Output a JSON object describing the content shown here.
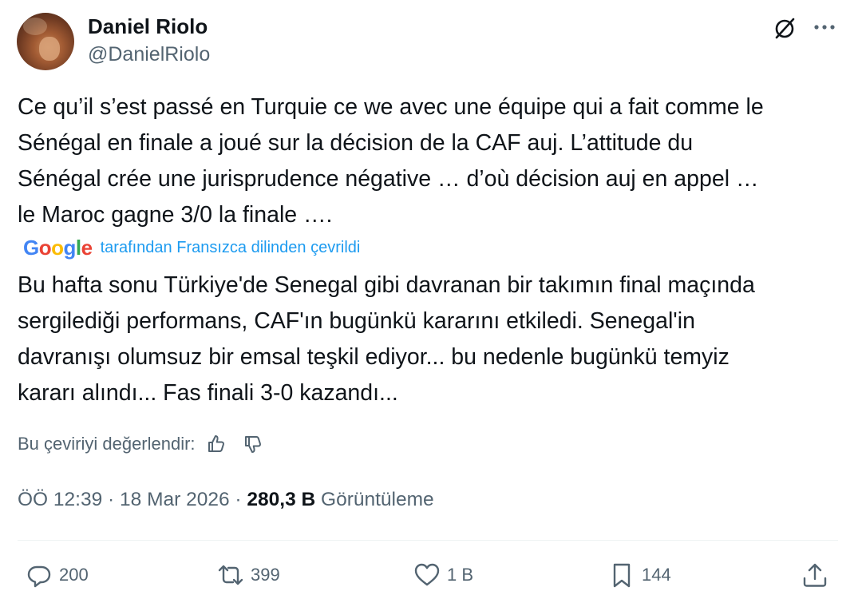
{
  "author": {
    "name": "Daniel Riolo",
    "handle": "@DanielRiolo"
  },
  "tweet": {
    "original_lines": [
      "Ce qu’il s’est passé en Turquie ce we avec une équipe qui a fait comme le",
      "Sénégal en finale a joué sur la décision de la CAF auj. L’attitude du",
      "Sénégal crée une jurisprudence négative … d’où décision auj en appel …",
      "le Maroc gagne 3/0 la finale …."
    ],
    "translation_credit": "tarafından Fransızca dilinden çevrildi",
    "translated_lines": [
      "Bu hafta sonu Türkiye'de Senegal gibi davranan bir takımın final maçında",
      "sergilediği performans, CAF'ın bugünkü kararını etkiledi. Senegal'in",
      "davranışı olumsuz bir emsal teşkil ediyor... bu nedenle bugünkü temyiz",
      "kararı alındı... Fas finali 3-0 kazandı..."
    ],
    "rate_label": "Bu çeviriyi değerlendir:"
  },
  "meta": {
    "time": "ÖÖ 12:39",
    "date": "18 Mar 2026",
    "separator": "·",
    "views_count": "280,3 B",
    "views_label": "Görüntüleme"
  },
  "actions": {
    "replies": "200",
    "reposts": "399",
    "likes": "1 B",
    "bookmarks": "144"
  },
  "icons": [
    "grok-icon",
    "more-icon",
    "thumbs-up-icon",
    "thumbs-down-icon",
    "reply-icon",
    "repost-icon",
    "like-icon",
    "bookmark-icon",
    "share-icon"
  ],
  "colors": {
    "text": "#0f1419",
    "secondary": "#536471",
    "link": "#1d9bf0",
    "divider": "#eff3f4"
  }
}
